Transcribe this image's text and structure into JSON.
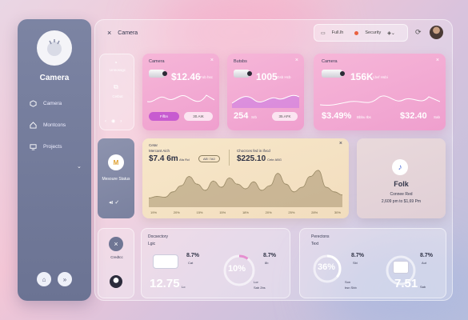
{
  "sidebar": {
    "title": "Camera",
    "items": [
      {
        "label": "Camera",
        "icon": "cube-icon"
      },
      {
        "label": "Montcons",
        "icon": "home-icon"
      },
      {
        "label": "Projects",
        "icon": "monitor-icon"
      }
    ]
  },
  "header": {
    "title": "Camera",
    "pills": {
      "a": "Full.lh",
      "b": "Security"
    }
  },
  "mini_panel": {
    "item1": "Unnossgc",
    "item2": "Cetbat"
  },
  "cam_card_1": {
    "title": "Camera",
    "value": "$12.46",
    "sub": "Fob hsc",
    "btn_primary": "Fifbn",
    "btn_secondary": "30.AIK"
  },
  "cam_card_2": {
    "title": "Butsbs",
    "value": "1005",
    "value_sub": "Gsb Hcb",
    "bottom": "254",
    "bottom_sub": "Srb",
    "btn": "35.AFK"
  },
  "cam_card_3": {
    "title": "Camera",
    "value": "156K",
    "value_sub": "Lbvf Hsbi",
    "pct": "$3.49%",
    "pct_sub": "Bbbu Ibs",
    "amount": "$32.40",
    "amount_sub": "Sab"
  },
  "status_card": {
    "label": "Mesoure Status",
    "badge": "M"
  },
  "chart_card": {
    "title": "Cetar",
    "metric1_label": "Mercant Aich",
    "metric1_value": "$7.4 6m",
    "metric1_sub": "Afa Rcl",
    "badge": "AEI 7A0",
    "metric2_label": "Chocrces fed in ifvcd",
    "metric2_value": "$225.10",
    "metric2_sub": "Cebr ABG",
    "ticks": [
      "19%",
      "20%",
      "15%",
      "15%",
      "18%",
      "20%",
      "25%",
      "28%",
      "30%"
    ]
  },
  "chart_data": {
    "type": "area",
    "x": [
      0,
      1,
      2,
      3,
      4,
      5,
      6,
      7,
      8,
      9,
      10,
      11,
      12,
      13,
      14,
      15,
      16,
      17,
      18,
      19,
      20,
      21,
      22,
      23,
      24
    ],
    "values": [
      12,
      14,
      13,
      20,
      28,
      40,
      30,
      22,
      34,
      26,
      38,
      30,
      24,
      33,
      22,
      28,
      44,
      30,
      20,
      26,
      40,
      48,
      26,
      20,
      16
    ]
  },
  "folk_card": {
    "title": "Folk",
    "line1": "Connee Red",
    "line2": "2,609 pm to $1,69 Pm"
  },
  "side_small": {
    "label": "Credtcc"
  },
  "bottom1": {
    "title": "Docsectory",
    "subtitle": "Lgic",
    "pct_a": "8.7%",
    "pct_a_sub": "Cat",
    "pct_b": "8.7%",
    "pct_b_sub": "8b",
    "value": "12.75",
    "value_sub": "Lo",
    "donut": "10%",
    "donut_sub": "Lor",
    "donut_sub2": "Sab 2bs",
    "donut_fraction": 0.1
  },
  "bottom2": {
    "title": "Perectons",
    "subtitle": "Text",
    "pct_a": "8.7%",
    "pct_a_sub": "Sbi",
    "donut": "36%",
    "donut_sub": "Son",
    "donut_sub2": "bsn Sbb",
    "donut_fraction": 0.36,
    "pct_b": "8.7%",
    "pct_b_sub": "Aut",
    "value": "7.51",
    "value_sub": "Sab"
  },
  "colors": {
    "accent": "#c75bd0",
    "pink": "#ef9fce",
    "slate": "#6b7393",
    "cream": "#f2ddbe"
  }
}
